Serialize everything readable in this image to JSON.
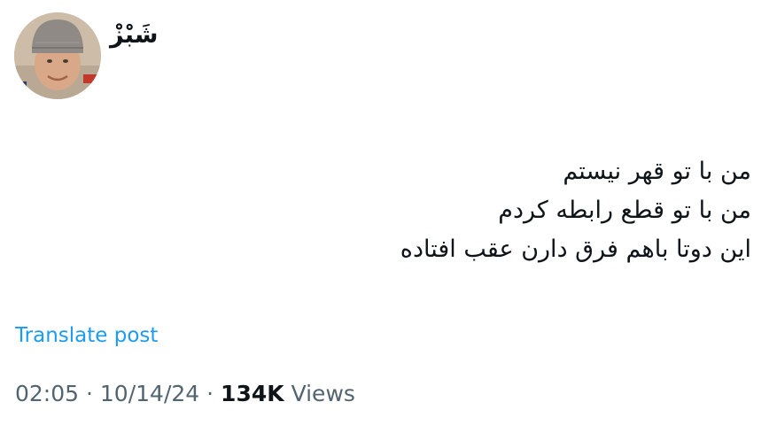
{
  "author": {
    "display_name": "شَبْزْ"
  },
  "post": {
    "lines": [
      "من با تو قهر نیستم",
      "من با تو قطع رابطه کردم",
      "این دوتا باهم فرق دارن عقب افتاده"
    ]
  },
  "translate_label": "Translate post",
  "meta": {
    "time": "02:05",
    "separator": "·",
    "date": "10/14/24",
    "views_count": "134K",
    "views_label": "Views"
  },
  "colors": {
    "link": "#1d9bf0",
    "text": "#0f1419",
    "secondary": "#536471"
  }
}
